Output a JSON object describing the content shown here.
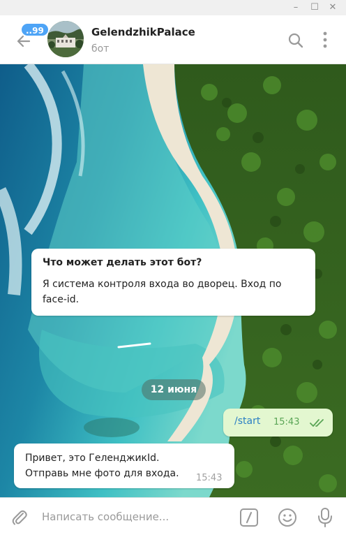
{
  "window": {
    "minimize_glyph": "–",
    "maximize_glyph": "☐",
    "close_glyph": "✕"
  },
  "header": {
    "back_icon": "arrow-left-icon",
    "unread_badge": "..99",
    "chat_title": "GelendzhikPalace",
    "chat_subtitle": "бот",
    "search_icon": "search-icon",
    "more_icon": "more-vertical-icon"
  },
  "info_card": {
    "title": "Что может делать этот бот?",
    "text": "Я система контроля входа во дворец. Вход по face-id."
  },
  "date_separator": "12 июня",
  "messages": [
    {
      "direction": "outgoing",
      "text": "/start",
      "time": "15:43",
      "status": "read"
    },
    {
      "direction": "incoming",
      "lines": [
        "Привет, это ГеленджикId.",
        "Отправь мне фото для входа."
      ],
      "time": "15:43"
    }
  ],
  "input": {
    "placeholder": "Написать сообщение...",
    "attach_icon": "paperclip-icon",
    "command_icon": "slash-command-icon",
    "emoji_icon": "emoji-icon",
    "mic_icon": "microphone-icon"
  },
  "colors": {
    "accent": "#4ea4f6",
    "outgoing_bubble": "#e3f7d0",
    "outgoing_time": "#5aa556",
    "link": "#2a7fc4"
  }
}
